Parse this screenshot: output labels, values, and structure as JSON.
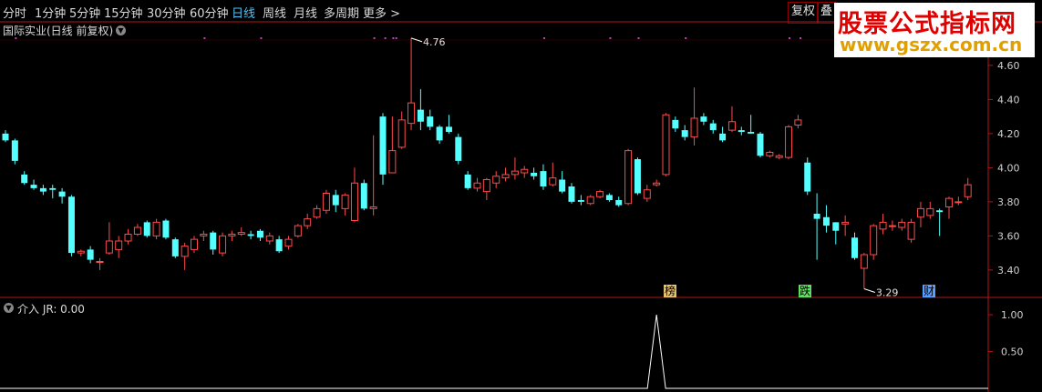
{
  "toolbar": {
    "periods": [
      "分时",
      "1分钟",
      "5分钟",
      "15分钟",
      "30分钟",
      "60分钟",
      "日线",
      "周线",
      "月线",
      "多周期",
      "更多 >"
    ],
    "active_index": 6,
    "right_buttons": [
      "复权",
      "叠"
    ]
  },
  "stock_title": "国际实业(日线 前复权)",
  "indicator_title": "介入  JR: 0.00",
  "watermark": {
    "line1": "股票公式指标网",
    "line2": "www.gszx.com.cn"
  },
  "colors": {
    "up": "#ff4a4a",
    "down": "#54ffff",
    "axis": "#b01818",
    "label": "#d0d0d0",
    "accent_bg": "#000000"
  },
  "markers": [
    {
      "text": "榜",
      "color": "#e8c070"
    },
    {
      "text": "跌",
      "color": "#60e060"
    },
    {
      "text": "财",
      "color": "#5aa0ff"
    }
  ],
  "chart_data": [
    {
      "type": "candlestick",
      "title": "国际实业(日线 前复权)",
      "ylim": [
        3.25,
        4.77
      ],
      "y_ticks": [
        "4.60",
        "4.40",
        "4.20",
        "4.00",
        "3.80",
        "3.60",
        "3.40"
      ],
      "annotations": [
        {
          "text": "4.76",
          "value": 4.76
        },
        {
          "text": "3.29",
          "value": 3.29
        }
      ],
      "candles": [
        [
          4.2,
          4.16,
          4.22,
          4.15
        ],
        [
          4.16,
          4.04,
          4.17,
          4.02
        ],
        [
          3.96,
          3.91,
          3.98,
          3.9
        ],
        [
          3.9,
          3.88,
          3.93,
          3.87
        ],
        [
          3.88,
          3.86,
          3.9,
          3.84
        ],
        [
          3.88,
          3.87,
          3.9,
          3.82
        ],
        [
          3.86,
          3.83,
          3.88,
          3.79
        ],
        [
          3.83,
          3.5,
          3.84,
          3.48
        ],
        [
          3.5,
          3.51,
          3.52,
          3.48
        ],
        [
          3.52,
          3.46,
          3.54,
          3.44
        ],
        [
          3.45,
          3.45,
          3.47,
          3.4
        ],
        [
          3.5,
          3.57,
          3.68,
          3.49
        ],
        [
          3.52,
          3.57,
          3.6,
          3.47
        ],
        [
          3.57,
          3.61,
          3.64,
          3.55
        ],
        [
          3.61,
          3.65,
          3.67,
          3.6
        ],
        [
          3.68,
          3.6,
          3.69,
          3.59
        ],
        [
          3.6,
          3.68,
          3.7,
          3.58
        ],
        [
          3.69,
          3.59,
          3.7,
          3.58
        ],
        [
          3.58,
          3.48,
          3.59,
          3.47
        ],
        [
          3.48,
          3.54,
          3.56,
          3.4
        ],
        [
          3.52,
          3.58,
          3.6,
          3.5
        ],
        [
          3.6,
          3.61,
          3.63,
          3.57
        ],
        [
          3.62,
          3.52,
          3.63,
          3.49
        ],
        [
          3.5,
          3.6,
          3.62,
          3.48
        ],
        [
          3.6,
          3.61,
          3.63,
          3.57
        ],
        [
          3.61,
          3.62,
          3.65,
          3.6
        ],
        [
          3.61,
          3.6,
          3.63,
          3.58
        ],
        [
          3.63,
          3.59,
          3.64,
          3.57
        ],
        [
          3.57,
          3.6,
          3.62,
          3.55
        ],
        [
          3.58,
          3.51,
          3.6,
          3.5
        ],
        [
          3.54,
          3.58,
          3.6,
          3.52
        ],
        [
          3.6,
          3.66,
          3.67,
          3.59
        ],
        [
          3.66,
          3.7,
          3.73,
          3.64
        ],
        [
          3.71,
          3.76,
          3.78,
          3.7
        ],
        [
          3.75,
          3.85,
          3.87,
          3.73
        ],
        [
          3.84,
          3.78,
          3.87,
          3.74
        ],
        [
          3.76,
          3.84,
          3.85,
          3.72
        ],
        [
          3.69,
          3.91,
          4.0,
          3.68
        ],
        [
          3.91,
          3.76,
          3.93,
          3.75
        ],
        [
          3.76,
          3.77,
          4.19,
          3.72
        ],
        [
          4.3,
          3.96,
          4.32,
          3.9
        ],
        [
          3.97,
          4.1,
          4.3,
          3.97
        ],
        [
          4.12,
          4.28,
          4.33,
          4.11
        ],
        [
          4.26,
          4.38,
          4.76,
          4.22
        ],
        [
          4.34,
          4.27,
          4.46,
          4.22
        ],
        [
          4.3,
          4.24,
          4.34,
          4.22
        ],
        [
          4.24,
          4.16,
          4.25,
          4.14
        ],
        [
          4.24,
          4.21,
          4.31,
          4.2
        ],
        [
          4.18,
          4.04,
          4.2,
          4.02
        ],
        [
          3.96,
          3.88,
          3.98,
          3.87
        ],
        [
          3.88,
          3.91,
          3.94,
          3.86
        ],
        [
          3.86,
          3.93,
          3.94,
          3.81
        ],
        [
          3.91,
          3.95,
          3.98,
          3.88
        ],
        [
          3.94,
          3.96,
          4.0,
          3.92
        ],
        [
          3.96,
          3.98,
          4.06,
          3.93
        ],
        [
          3.97,
          3.99,
          4.01,
          3.94
        ],
        [
          3.97,
          3.95,
          4.0,
          3.93
        ],
        [
          3.98,
          3.89,
          4.02,
          3.87
        ],
        [
          3.9,
          3.94,
          4.03,
          3.89
        ],
        [
          3.93,
          3.86,
          3.98,
          3.85
        ],
        [
          3.89,
          3.8,
          3.91,
          3.79
        ],
        [
          3.81,
          3.8,
          3.84,
          3.78
        ],
        [
          3.79,
          3.83,
          3.84,
          3.78
        ],
        [
          3.83,
          3.86,
          3.87,
          3.82
        ],
        [
          3.84,
          3.81,
          3.85,
          3.8
        ],
        [
          3.81,
          3.78,
          3.83,
          3.77
        ],
        [
          3.79,
          4.1,
          4.11,
          3.78
        ],
        [
          4.05,
          3.85,
          4.06,
          3.84
        ],
        [
          3.82,
          3.87,
          3.9,
          3.8
        ],
        [
          3.9,
          3.91,
          3.93,
          3.89
        ],
        [
          3.96,
          4.31,
          4.32,
          3.95
        ],
        [
          4.28,
          4.23,
          4.3,
          4.21
        ],
        [
          4.22,
          4.18,
          4.25,
          4.16
        ],
        [
          4.18,
          4.29,
          4.47,
          4.13
        ],
        [
          4.3,
          4.27,
          4.32,
          4.25
        ],
        [
          4.26,
          4.22,
          4.28,
          4.2
        ],
        [
          4.2,
          4.16,
          4.24,
          4.15
        ],
        [
          4.22,
          4.27,
          4.36,
          4.21
        ],
        [
          4.22,
          4.21,
          4.24,
          4.19
        ],
        [
          4.21,
          4.2,
          4.31,
          4.2
        ],
        [
          4.2,
          4.07,
          4.21,
          4.06
        ],
        [
          4.07,
          4.09,
          4.1,
          4.06
        ],
        [
          4.06,
          4.07,
          4.08,
          4.05
        ],
        [
          4.06,
          4.24,
          4.25,
          4.05
        ],
        [
          4.25,
          4.28,
          4.31,
          4.23
        ],
        [
          4.03,
          3.86,
          4.06,
          3.84
        ],
        [
          3.73,
          3.7,
          3.85,
          3.46
        ],
        [
          3.71,
          3.66,
          3.78,
          3.62
        ],
        [
          3.68,
          3.63,
          3.68,
          3.55
        ],
        [
          3.67,
          3.68,
          3.72,
          3.6
        ],
        [
          3.59,
          3.47,
          3.62,
          3.46
        ],
        [
          3.41,
          3.49,
          3.5,
          3.29
        ],
        [
          3.49,
          3.66,
          3.67,
          3.46
        ],
        [
          3.64,
          3.68,
          3.73,
          3.61
        ],
        [
          3.66,
          3.66,
          3.69,
          3.63
        ],
        [
          3.65,
          3.68,
          3.7,
          3.63
        ],
        [
          3.58,
          3.68,
          3.7,
          3.56
        ],
        [
          3.71,
          3.76,
          3.8,
          3.65
        ],
        [
          3.72,
          3.76,
          3.8,
          3.7
        ],
        [
          3.75,
          3.74,
          3.76,
          3.6
        ],
        [
          3.77,
          3.82,
          3.83,
          3.7
        ],
        [
          3.8,
          3.8,
          3.83,
          3.78
        ],
        [
          3.83,
          3.9,
          3.94,
          3.81
        ]
      ]
    },
    {
      "type": "line",
      "title": "介入",
      "series": [
        {
          "name": "JR",
          "peak_index": 69,
          "peak_value": 1.0,
          "baseline": 0.0
        }
      ],
      "ylim": [
        0,
        1.1
      ],
      "y_ticks": [
        "1.00",
        "0.50"
      ]
    }
  ]
}
